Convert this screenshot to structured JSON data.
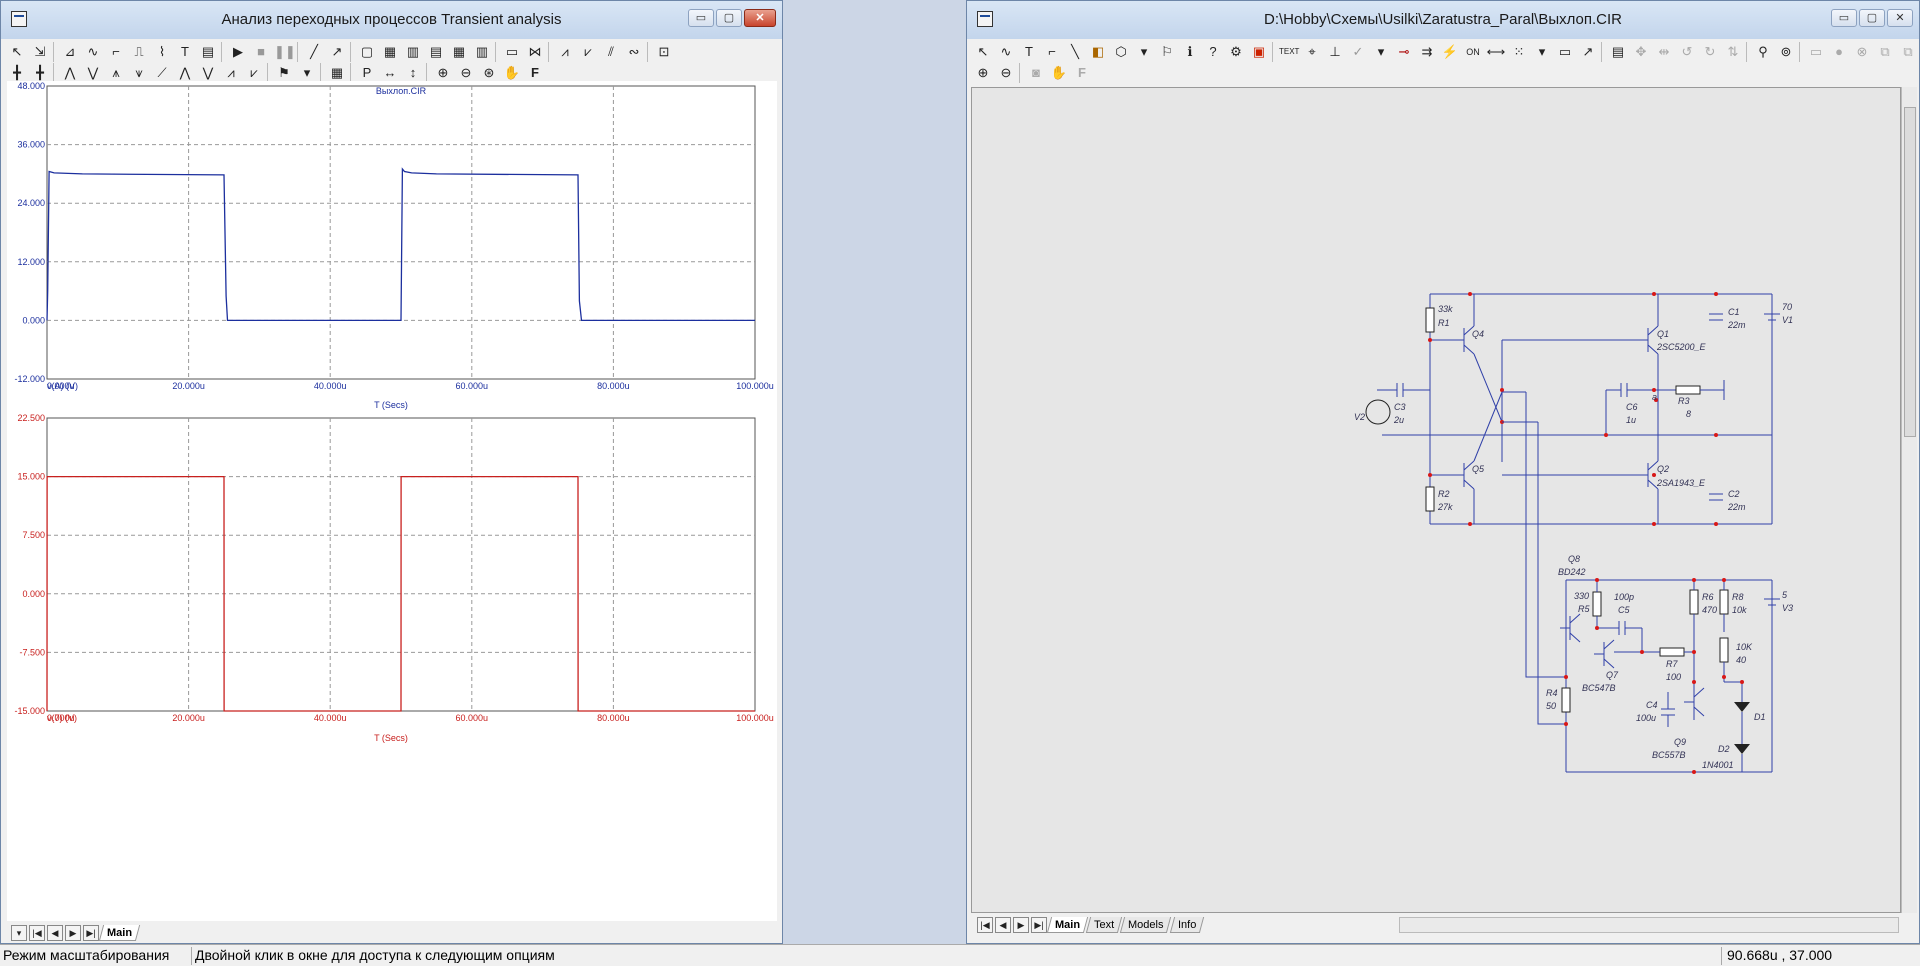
{
  "left_window": {
    "title": "Анализ переходных процессов Transient analysis",
    "chart_title": "Выхлоп.CIR",
    "tabs": [
      "Main"
    ]
  },
  "right_window": {
    "title": "D:\\Hobby\\Схемы\\Usilki\\Zaratustra_Paral\\Выхлоп.CIR",
    "tabs": [
      "Main",
      "Text",
      "Models",
      "Info"
    ]
  },
  "window_buttons": {
    "minimize": "▭",
    "maximize": "▢",
    "close": "✕"
  },
  "nav_buttons": [
    "▾",
    "|◀",
    "◀",
    "▶",
    "▶|"
  ],
  "status": {
    "mode": "Режим масштабирования",
    "hint": "Двойной клик в окне для доступа к следующим опциям",
    "coords": "90.668u , 37.000"
  },
  "chart_data": [
    {
      "type": "line",
      "title": "Выхлоп.CIR",
      "xlabel": "T (Secs)",
      "ylabel": "v(A) (V)",
      "xlim": [
        0,
        100
      ],
      "ylim": [
        -12,
        48
      ],
      "xticks": [
        "0.000u",
        "20.000u",
        "40.000u",
        "60.000u",
        "80.000u",
        "100.000u"
      ],
      "yticks": [
        "-12.000",
        "0.000",
        "12.000",
        "24.000",
        "36.000",
        "48.000"
      ],
      "grid": true,
      "color": "#1c2f9e",
      "series": [
        {
          "name": "v(A) (V)",
          "x": [
            0,
            0.1,
            0.3,
            1.0,
            5,
            25,
            25.3,
            25.5,
            50,
            50.2,
            50.5,
            51.5,
            55,
            75,
            75.2,
            75.5,
            100
          ],
          "y": [
            0,
            6,
            30.5,
            30.2,
            30.0,
            29.8,
            5,
            0,
            0,
            31,
            30.5,
            30.2,
            30.0,
            29.8,
            4,
            0,
            0
          ]
        }
      ]
    },
    {
      "type": "line",
      "xlabel": "T (Secs)",
      "ylabel": "v(7) (V)",
      "xlim": [
        0,
        100
      ],
      "ylim": [
        -15,
        22.5
      ],
      "xticks": [
        "0.000u",
        "20.000u",
        "40.000u",
        "60.000u",
        "80.000u",
        "100.000u"
      ],
      "yticks": [
        "-15.000",
        "-7.500",
        "0.000",
        "7.500",
        "15.000",
        "22.500"
      ],
      "grid": true,
      "color": "#c8201e",
      "series": [
        {
          "name": "v(7) (V)",
          "x": [
            0,
            0.01,
            25,
            25.01,
            50,
            50.01,
            75,
            75.01,
            100
          ],
          "y": [
            -15,
            15,
            15,
            -15,
            -15,
            15,
            15,
            -15,
            -15
          ]
        }
      ]
    }
  ],
  "schematic": {
    "labels": {
      "r1": "R1",
      "r1v": "33k",
      "q4": "Q4",
      "q1": "Q1",
      "q1m": "2SC5200_E",
      "c1": "C1",
      "c1v": "22m",
      "v1": "V1",
      "v1v": "70",
      "v2": "V2",
      "c3": "C3",
      "c3v": "2u",
      "c6": "C6",
      "c6v": "1u",
      "r3": "R3",
      "r3v": "8",
      "a": "a",
      "r2": "R2",
      "r2v": "27k",
      "q5": "Q5",
      "q2": "Q2",
      "q2m": "2SA1943_E",
      "c2": "C2",
      "c2v": "22m",
      "q8": "Q8",
      "q8m": "BD242",
      "r5": "R5",
      "r5v": "330",
      "c5": "C5",
      "c5v": "100p",
      "r6": "R6",
      "r6v": "470",
      "r8": "R8",
      "r8v": "10k",
      "v3": "V3",
      "v3v": "5",
      "q7": "Q7",
      "q7m": "BC547B",
      "r7": "R7",
      "r7v": "100",
      "pot": "10K",
      "potv": "40",
      "r4": "R4",
      "r4v": "50",
      "c4": "C4",
      "c4v": "100u",
      "d1": "D1",
      "d2": "D2",
      "d2m": "1N4001",
      "q9": "Q9",
      "q9m": "BC557B"
    }
  },
  "colors": {
    "wire": "#3040a8",
    "node": "#d81818",
    "label": "#333355",
    "plot_blue": "#1c2f9e",
    "plot_red": "#c8201e"
  }
}
